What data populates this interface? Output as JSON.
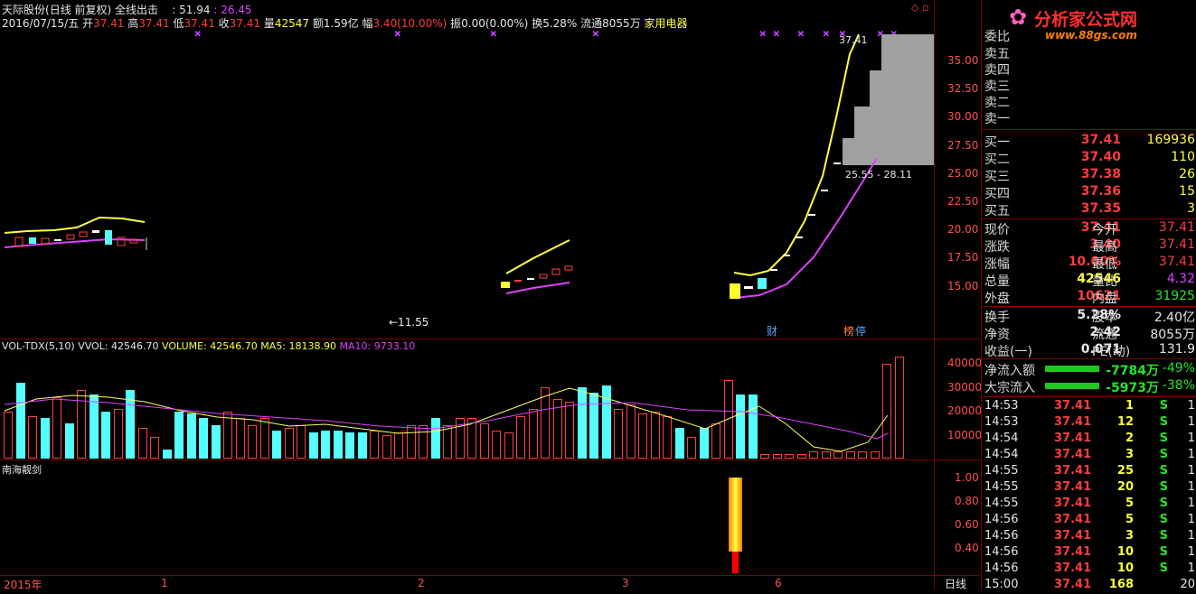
{
  "header": {
    "name": "天际股份",
    "mode": "(日线 前复权)",
    "indicator": "全线出击",
    "ind_v1": ": 51.94",
    "ind_v2": ": 26.45",
    "date": "2016/07/15/五",
    "open_label": "开",
    "open": "37.41",
    "high_label": "高",
    "high": "37.41",
    "low_label": "低",
    "low": "37.41",
    "close_label": "收",
    "close": "37.41",
    "vol_label": "量",
    "vol": "42547",
    "amt_label": "额",
    "amt": "1.59亿",
    "range_label": "幅",
    "range": "3.40(10.00%)",
    "amp": "振0.00(0.00%)",
    "turn": "换5.28%",
    "float": "流通8055万",
    "sector": "家用电器"
  },
  "logo": {
    "title": "分析家公式网",
    "url": "www.88gs.com"
  },
  "chart": {
    "price_ticks": [
      "35.00",
      "32.50",
      "30.00",
      "27.50",
      "25.00",
      "22.50",
      "20.00",
      "17.50",
      "15.00"
    ],
    "label_high": "37.41",
    "label_range": "25.55 - 28.11",
    "label_low": "←11.55",
    "tag_cai": "财",
    "tag_bang": "榜",
    "tag_ting": "停",
    "vol_title": "VOL-TDX(5,10)",
    "vvol": "VVOL: 42546.70",
    "volume": "VOLUME: 42546.70",
    "ma5": "MA5: 18138.90",
    "ma10": "MA10: 9733.10",
    "vol_ticks": [
      "40000",
      "30000",
      "20000",
      "10000"
    ],
    "sub_title": "南海靓剑",
    "sub_ticks": [
      "1.00",
      "0.80",
      "0.60",
      "0.40"
    ],
    "x_labels": [
      "2015年",
      "1",
      "2",
      "3",
      "6"
    ],
    "period": "日线",
    "volumes": [
      20,
      32,
      18,
      17,
      26,
      15,
      29,
      27,
      20,
      21,
      29,
      13,
      9,
      4,
      20,
      19,
      17,
      14,
      20,
      17,
      14,
      17,
      12,
      13,
      14,
      11,
      12,
      12,
      11,
      11,
      12,
      10,
      11,
      14,
      14,
      17,
      14,
      17,
      17,
      15,
      12,
      11,
      18,
      21,
      30,
      25,
      24,
      30,
      28,
      31,
      21,
      23,
      19,
      20,
      18,
      13,
      9,
      13,
      15,
      33,
      27,
      27,
      2,
      2,
      2,
      2,
      3,
      3,
      3,
      3,
      3,
      3,
      40,
      43
    ],
    "vol_colors": [
      "r",
      "c",
      "r",
      "c",
      "r",
      "c",
      "r",
      "c",
      "c",
      "r",
      "c",
      "r",
      "r",
      "c",
      "c",
      "c",
      "c",
      "c",
      "r",
      "r",
      "r",
      "r",
      "c",
      "r",
      "r",
      "c",
      "c",
      "c",
      "c",
      "c",
      "r",
      "r",
      "r",
      "r",
      "r",
      "c",
      "r",
      "r",
      "r",
      "r",
      "r",
      "r",
      "r",
      "r",
      "r",
      "r",
      "r",
      "c",
      "c",
      "c",
      "r",
      "r",
      "r",
      "r",
      "r",
      "c",
      "r",
      "c",
      "r",
      "r",
      "c",
      "c",
      "r",
      "r",
      "r",
      "r",
      "r",
      "r",
      "r",
      "r",
      "r",
      "r",
      "r",
      "r"
    ]
  },
  "panel": {
    "wei_label": "委比",
    "asks": [
      {
        "l": "卖五"
      },
      {
        "l": "卖四"
      },
      {
        "l": "卖三"
      },
      {
        "l": "卖二"
      },
      {
        "l": "卖一"
      }
    ],
    "bids": [
      {
        "l": "买一",
        "p": "37.41",
        "v": "169936"
      },
      {
        "l": "买二",
        "p": "37.40",
        "v": "110"
      },
      {
        "l": "买三",
        "p": "37.38",
        "v": "26"
      },
      {
        "l": "买四",
        "p": "37.36",
        "v": "15"
      },
      {
        "l": "买五",
        "p": "37.35",
        "v": "3"
      }
    ],
    "quote": [
      {
        "l": "现价",
        "m": "37.41",
        "l2": "今开",
        "r": "37.41",
        "mc": "red",
        "rc": "red"
      },
      {
        "l": "涨跌",
        "m": "3.40",
        "l2": "最高",
        "r": "37.41",
        "mc": "red",
        "rc": "red"
      },
      {
        "l": "涨幅",
        "m": "10.00%",
        "l2": "最低",
        "r": "37.41",
        "mc": "red",
        "rc": "red"
      },
      {
        "l": "总量",
        "m": "42546",
        "l2": "量比",
        "r": "4.32",
        "mc": "yel",
        "rc": "mag"
      },
      {
        "l": "外盘",
        "m": "10621",
        "l2": "内盘",
        "r": "31925",
        "mc": "red",
        "rc": "grn"
      }
    ],
    "fin": [
      {
        "l": "换手",
        "m": "5.28%",
        "l2": "股本",
        "r": "2.40亿"
      },
      {
        "l": "净资",
        "m": "2.42",
        "l2": "流通",
        "r": "8055万"
      },
      {
        "l": "收益(一)",
        "m": "0.071",
        "l2": "PE(动)",
        "r": "131.9"
      }
    ],
    "flow": [
      {
        "l": "净流入额",
        "v": "-7784万",
        "p": "-49%"
      },
      {
        "l": "大宗流入",
        "v": "-5973万",
        "p": "-38%"
      }
    ],
    "ticks": [
      {
        "t": "14:53",
        "p": "37.41",
        "v": "1",
        "s": "S",
        "z": "1"
      },
      {
        "t": "14:53",
        "p": "37.41",
        "v": "12",
        "s": "S",
        "z": "1"
      },
      {
        "t": "14:54",
        "p": "37.41",
        "v": "2",
        "s": "S",
        "z": "1"
      },
      {
        "t": "14:54",
        "p": "37.41",
        "v": "3",
        "s": "S",
        "z": "1"
      },
      {
        "t": "14:55",
        "p": "37.41",
        "v": "25",
        "s": "S",
        "z": "1"
      },
      {
        "t": "14:55",
        "p": "37.41",
        "v": "20",
        "s": "S",
        "z": "1"
      },
      {
        "t": "14:55",
        "p": "37.41",
        "v": "5",
        "s": "S",
        "z": "1"
      },
      {
        "t": "14:56",
        "p": "37.41",
        "v": "5",
        "s": "S",
        "z": "1"
      },
      {
        "t": "14:56",
        "p": "37.41",
        "v": "3",
        "s": "S",
        "z": "1"
      },
      {
        "t": "14:56",
        "p": "37.41",
        "v": "10",
        "s": "S",
        "z": "1"
      },
      {
        "t": "14:56",
        "p": "37.41",
        "v": "10",
        "s": "S",
        "z": "1"
      },
      {
        "t": "15:00",
        "p": "37.41",
        "v": "168",
        "s": "",
        "z": "20"
      }
    ]
  }
}
